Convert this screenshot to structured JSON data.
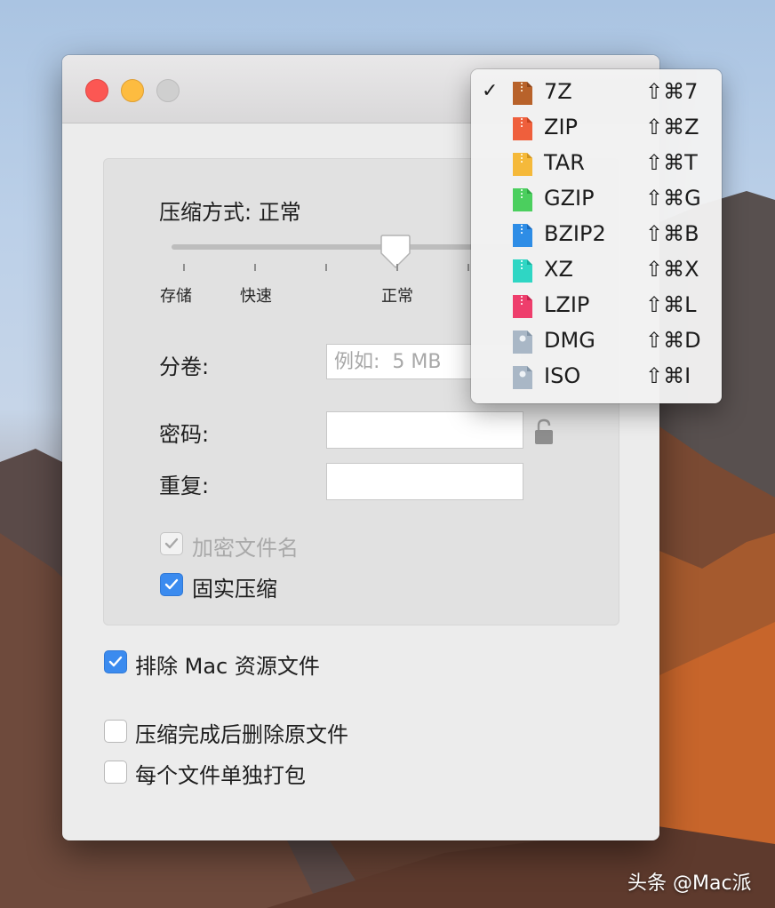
{
  "compression": {
    "method_label": "压缩方式: 正常",
    "slider_value": "正常",
    "ticks": [
      "存储",
      "快速",
      "正常"
    ]
  },
  "split": {
    "label": "分卷:",
    "placeholder": "例如:  5 MB"
  },
  "password": {
    "label": "密码:",
    "value": ""
  },
  "repeat": {
    "label": "重复:",
    "value": ""
  },
  "options": {
    "encrypt_names": {
      "label": "加密文件名",
      "checked": true,
      "enabled": false
    },
    "solid": {
      "label": "固实压缩",
      "checked": true
    },
    "exclude_mac": {
      "label": "排除 Mac 资源文件",
      "checked": true
    },
    "delete_after": {
      "label": "压缩完成后删除原文件",
      "checked": false
    },
    "separate": {
      "label": "每个文件单独打包",
      "checked": false
    }
  },
  "format_menu": {
    "selected": "7Z",
    "items": [
      {
        "name": "7Z",
        "shortcut": "⇧⌘7",
        "color": "#b8622a",
        "icon": "archive-icon"
      },
      {
        "name": "ZIP",
        "shortcut": "⇧⌘Z",
        "color": "#ef5f3c",
        "icon": "archive-icon"
      },
      {
        "name": "TAR",
        "shortcut": "⇧⌘T",
        "color": "#f5b93a",
        "icon": "archive-icon"
      },
      {
        "name": "GZIP",
        "shortcut": "⇧⌘G",
        "color": "#4bcf5e",
        "icon": "archive-icon"
      },
      {
        "name": "BZIP2",
        "shortcut": "⇧⌘B",
        "color": "#2e8de6",
        "icon": "archive-icon"
      },
      {
        "name": "XZ",
        "shortcut": "⇧⌘X",
        "color": "#2fd6c4",
        "icon": "archive-icon"
      },
      {
        "name": "LZIP",
        "shortcut": "⇧⌘L",
        "color": "#ee3e6c",
        "icon": "archive-icon"
      },
      {
        "name": "DMG",
        "shortcut": "⇧⌘D",
        "color": "#a9b7c6",
        "icon": "disk-image-icon"
      },
      {
        "name": "ISO",
        "shortcut": "⇧⌘I",
        "color": "#a9b7c6",
        "icon": "disk-image-icon"
      }
    ]
  },
  "watermark": "头条 @Mac派"
}
